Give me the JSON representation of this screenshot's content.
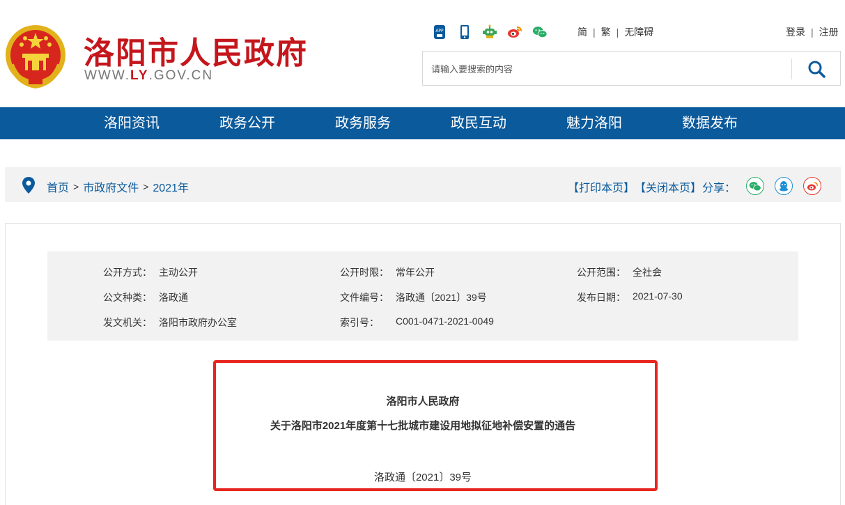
{
  "header": {
    "site_title": "洛阳市人民政府",
    "domain_pre": "WWW.",
    "domain_hl": "LY",
    "domain_post": ".GOV.CN",
    "icons": [
      "app-icon",
      "mobile-icon",
      "robot-icon",
      "weibo-icon",
      "wechat-icon"
    ],
    "lang": {
      "simplified": "简",
      "traditional": "繁",
      "accessible": "无障碍"
    },
    "account": {
      "login": "登录",
      "register": "注册"
    },
    "search": {
      "placeholder": "请输入要搜索的内容",
      "button_icon": "search-icon"
    }
  },
  "nav": {
    "items": [
      "洛阳资讯",
      "政务公开",
      "政务服务",
      "政民互动",
      "魅力洛阳",
      "数据发布"
    ]
  },
  "breadcrumb": {
    "items": [
      "首页",
      "市政府文件",
      "2021年"
    ],
    "separator": ">",
    "print": "【打印本页】",
    "close": "【关闭本页】",
    "share_label": "分享：",
    "share_icons": [
      "wechat-icon",
      "qq-icon",
      "weibo-icon"
    ]
  },
  "meta": {
    "disclosure_method_label": "公开方式：",
    "disclosure_method": "主动公开",
    "disclosure_period_label": "公开时限：",
    "disclosure_period": "常年公开",
    "disclosure_scope_label": "公开范围：",
    "disclosure_scope": "全社会",
    "doc_type_label": "公文种类：",
    "doc_type": "洛政通",
    "doc_number_label": "文件编号：",
    "doc_number": "洛政通〔2021〕39号",
    "publish_date_label": "发布日期：",
    "publish_date": "2021-07-30",
    "issuer_label": "发文机关：",
    "issuer": "洛阳市政府办公室",
    "index_label": "索引号：",
    "index": "C001-0471-2021-0049"
  },
  "document": {
    "org": "洛阳市人民政府",
    "title": "关于洛阳市2021年度第十七批城市建设用地拟征地补偿安置的通告",
    "number": "洛政通〔2021〕39号"
  },
  "colors": {
    "brand_red": "#c4161c",
    "nav_blue": "#0b5a9c",
    "highlight_box": "#e8251e",
    "wechat_green": "#2aae67",
    "qq_blue": "#1e90d6",
    "weibo_red": "#e6362f"
  }
}
